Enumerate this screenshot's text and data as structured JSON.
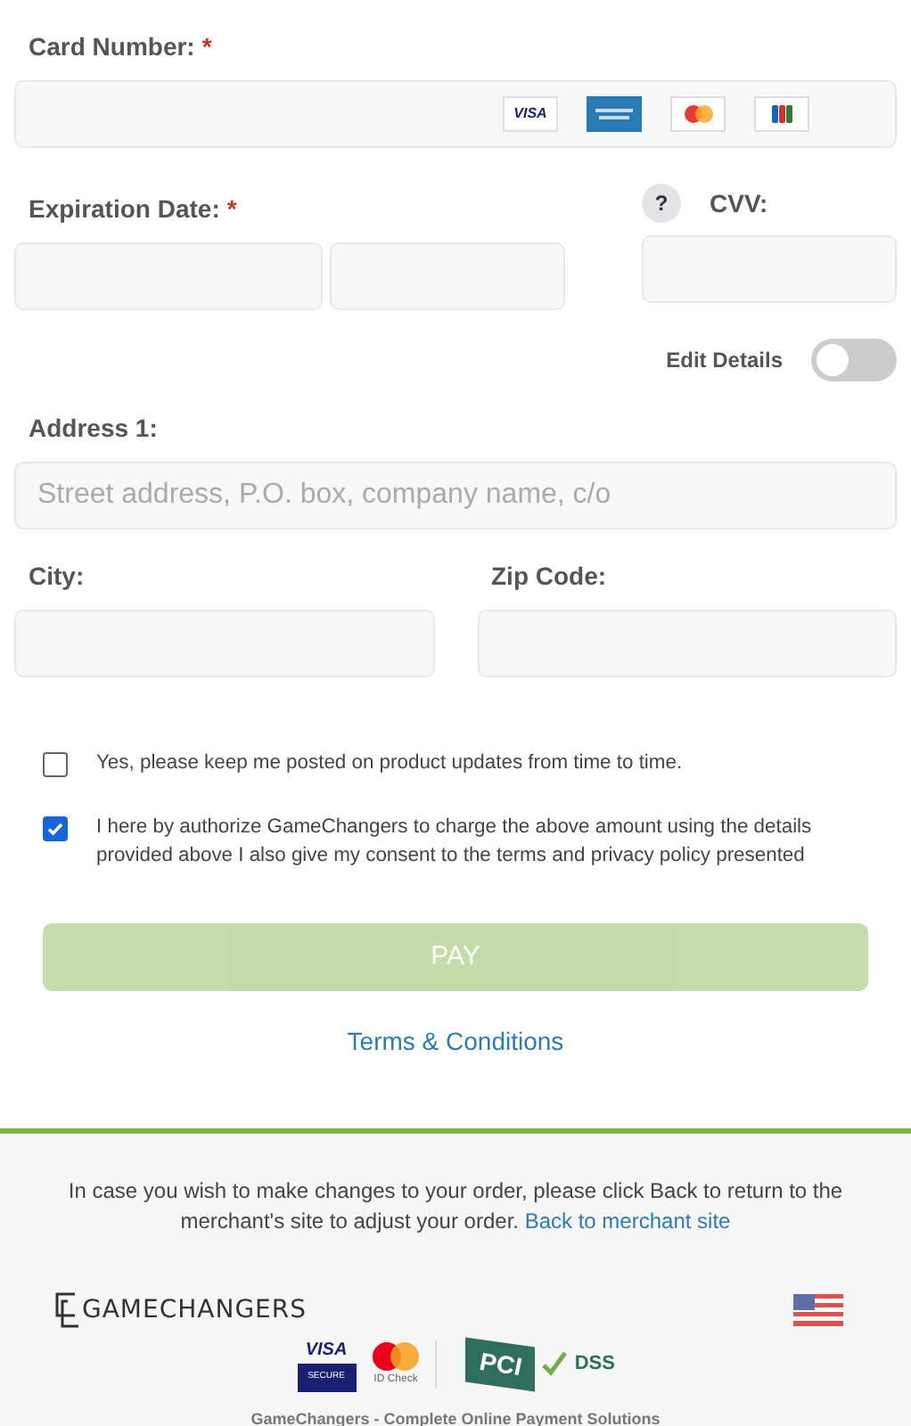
{
  "card_number": {
    "label": "Card Number:",
    "required_mark": "*",
    "brands": [
      {
        "kind": "visa",
        "label": "VISA"
      },
      {
        "kind": "amex"
      },
      {
        "kind": "mastercard"
      },
      {
        "kind": "jcb"
      }
    ]
  },
  "expiration": {
    "label": "Expiration Date:",
    "required_mark": "*"
  },
  "cvv": {
    "label": "CVV:",
    "help": "?"
  },
  "edit_details": {
    "label": "Edit Details",
    "on": false
  },
  "address": {
    "label": "Address 1:",
    "placeholder": "Street address, P.O. box, company name, c/o"
  },
  "city": {
    "label": "City:"
  },
  "zip": {
    "label": "Zip Code:"
  },
  "consents": [
    {
      "text": "Yes, please keep me posted on product updates from time to time.",
      "checked": false
    },
    {
      "text": "I here by authorize GameChangers to charge the above amount using the details provided above I also give my consent to the terms and privacy policy presented",
      "checked": true
    }
  ],
  "pay_button": {
    "label": "PAY",
    "disabled": true
  },
  "terms_link": "Terms & Conditions",
  "footer": {
    "notice": "In case you wish to make changes to your order, please click Back to return to the merchant's site to adjust your order.",
    "back_link": "Back to merchant site",
    "logo_text": "GAMECHANGERS",
    "badges": [
      {
        "kind": "visa_secure",
        "line_1": "VISA",
        "line_2": "SECURE"
      },
      {
        "kind": "mastercard_id",
        "caption": "ID Check"
      },
      {
        "kind": "pci",
        "mark": "PCI",
        "caption": "DSS"
      }
    ],
    "tagline": "GameChangers - Complete Online Payment Solutions"
  }
}
